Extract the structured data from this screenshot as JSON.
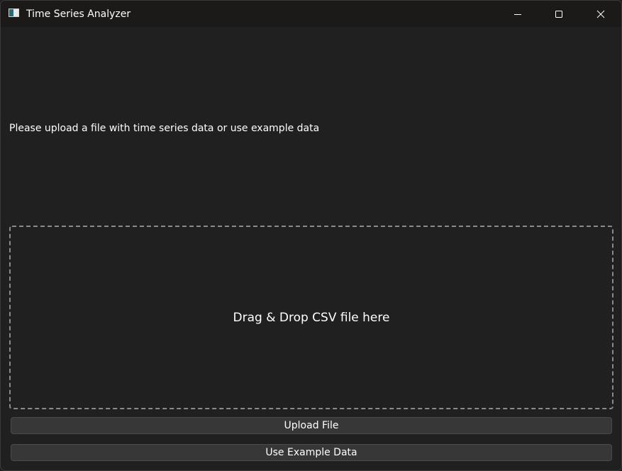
{
  "window": {
    "title": "Time Series Analyzer",
    "controls": {
      "minimize": "minimize-icon",
      "maximize": "maximize-icon",
      "close": "close-icon"
    }
  },
  "main": {
    "prompt": "Please upload a file with time series data or use example data",
    "dropzone_label": "Drag & Drop CSV file here",
    "upload_button": "Upload File",
    "example_button": "Use Example Data"
  },
  "colors": {
    "background": "#202020",
    "titlebar": "#1c1a19",
    "button": "#373737",
    "dropzone_border": "#8a8a8a",
    "text": "#ffffff"
  }
}
